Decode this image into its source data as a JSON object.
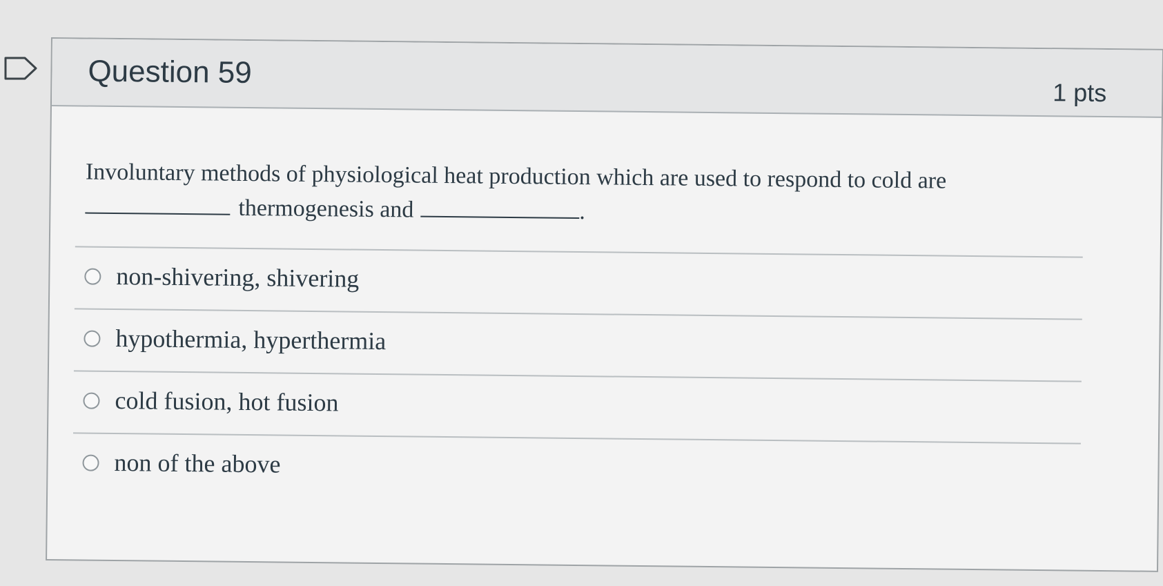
{
  "question": {
    "title": "Question 59",
    "points": "1 pts",
    "text_part1": "Involuntary methods of physiological heat production which are used to respond to cold are",
    "text_part2": "thermogenesis and",
    "text_end": "."
  },
  "answers": [
    {
      "label": "non-shivering, shivering",
      "selected": false
    },
    {
      "label": "hypothermia, hyperthermia",
      "selected": false
    },
    {
      "label": "cold fusion, hot fusion",
      "selected": false
    },
    {
      "label": "non of the above",
      "selected": false
    }
  ],
  "icons": {
    "flag": "flag-outline-icon",
    "radio": "radio-unchecked-icon"
  },
  "colors": {
    "text": "#2d3b45",
    "header_bg": "#e4e5e6",
    "border": "#9ea3a6"
  }
}
